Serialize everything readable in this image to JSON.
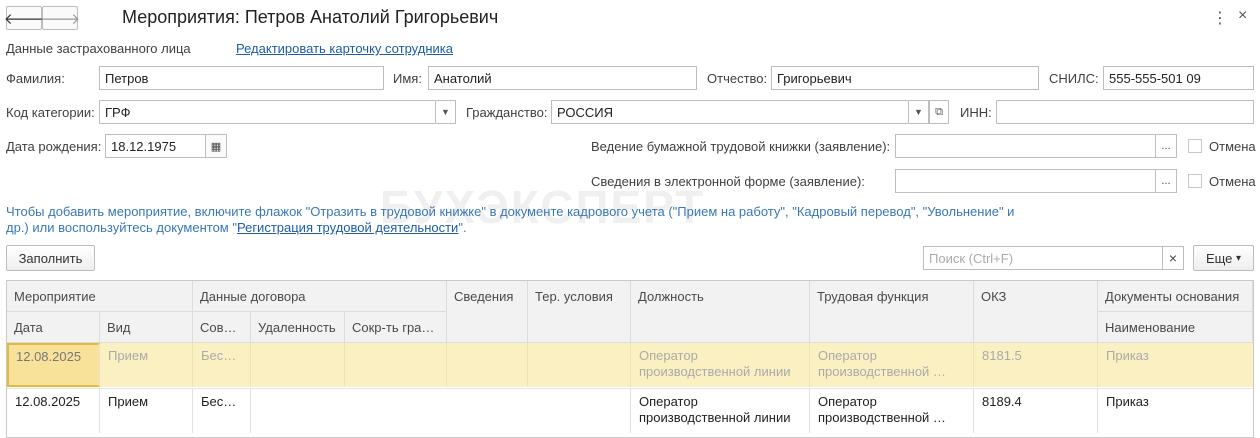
{
  "window": {
    "title": "Мероприятия: Петров Анатолий Григорьевич",
    "back_icon": "arrow-left-icon",
    "forward_icon": "arrow-right-icon"
  },
  "insured": {
    "section_label": "Данные застрахованного лица",
    "edit_link": "Редактировать карточку сотрудника",
    "last_name_label": "Фамилия:",
    "last_name": "Петров",
    "first_name_label": "Имя:",
    "first_name": "Анатолий",
    "patronymic_label": "Отчество:",
    "patronymic": "Григорьевич",
    "snils_label": "СНИЛС:",
    "snils": "555-555-501 09",
    "category_label": "Код категории:",
    "category": "ГРФ",
    "citizenship_label": "Гражданство:",
    "citizenship": "РОССИЯ",
    "inn_label": "ИНН:",
    "inn": "",
    "birth_label": "Дата рождения:",
    "birth_date": "18.12.1975"
  },
  "statements": {
    "paper_label": "Ведение бумажной трудовой книжки (заявление):",
    "paper_value": "",
    "electronic_label": "Сведения в электронной форме (заявление):",
    "electronic_value": "",
    "cancel_label": "Отмена",
    "select_glyph": "..."
  },
  "hint": {
    "text1": "Чтобы добавить мероприятие, включите флажок \"Отразить в трудовой книжке\" в документе кадрового учета (\"Прием на работу\", \"Кадровый перевод\", \"Увольнение\" и др.) или воспользуйтесь документом \"",
    "link": "Регистрация трудовой деятельности",
    "text2": "\"."
  },
  "watermark": "БУХЭКСПЕРТ",
  "toolbar": {
    "fill_button": "Заполнить",
    "search_placeholder": "Поиск (Ctrl+F)",
    "clear_glyph": "×",
    "more_button": "Еще",
    "more_glyph": "▾"
  },
  "table": {
    "groups": {
      "event": "Мероприятие",
      "contract": "Данные договора",
      "info": "Сведения",
      "terr": "Тер. условия",
      "position": "Должность",
      "function": "Трудовая функция",
      "okz": "ОКЗ",
      "docs": "Документы основания"
    },
    "subheaders": {
      "date": "Дата",
      "kind": "Вид",
      "combo": "Сов…",
      "remote": "Удаленность",
      "reduced": "Сокр-ть гра…",
      "doc_name": "Наименование"
    },
    "rows": [
      {
        "date": "12.08.2025",
        "kind": "Прием",
        "combo": "Бес…",
        "remote": "",
        "reduced": "",
        "info": "",
        "terr": "",
        "position": "Оператор производственной линии",
        "function_line1": "Оператор",
        "function_line2": "производственной …",
        "okz": "8181.5",
        "doc": "Приказ"
      },
      {
        "date": "12.08.2025",
        "kind": "Прием",
        "combo": "Бес…",
        "remote": "",
        "reduced": "",
        "info": "",
        "terr": "",
        "position": "Оператор производственной линии",
        "function_line1": "Оператор",
        "function_line2": "производственной …",
        "okz": "8189.4",
        "doc": "Приказ"
      }
    ]
  }
}
